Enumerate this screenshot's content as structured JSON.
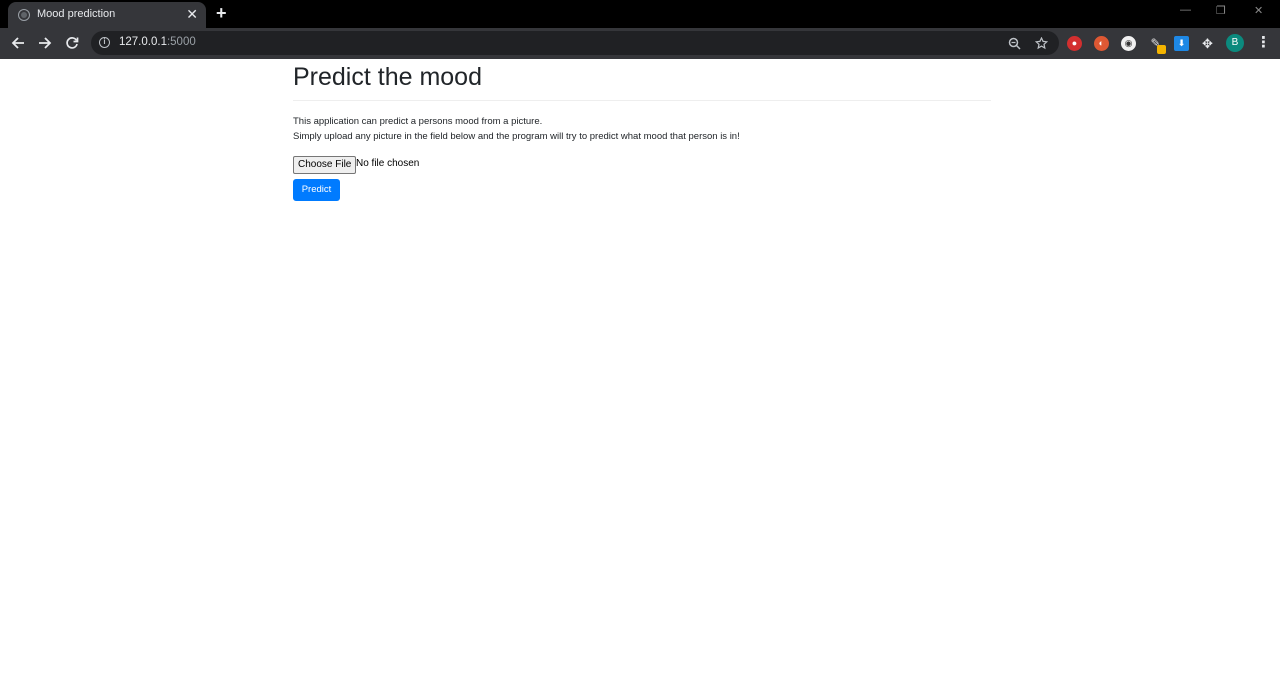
{
  "browser": {
    "tab_title": "Mood prediction",
    "tab_close": "✕",
    "new_tab": "+",
    "url_host": "127.0.0.1",
    "url_port": ":5000",
    "profile_initial": "B",
    "window_controls": {
      "minimize": "—",
      "maximize": "❐",
      "close": "✕"
    }
  },
  "page": {
    "title": "Predict the mood",
    "description_line1": "This application can predict a persons mood from a picture.",
    "description_line2": "Simply upload any picture in the field below and the program will try to predict what mood that person is in!",
    "file_input": {
      "button_label": "Choose File",
      "status": "No file chosen"
    },
    "submit_label": "Predict"
  },
  "colors": {
    "primary_button": "#007bff",
    "chrome_dark": "#35363a",
    "titlebar": "#000000"
  },
  "icons": [
    "globe-icon",
    "close-icon",
    "plus-icon",
    "back-arrow-icon",
    "forward-arrow-icon",
    "reload-icon",
    "info-icon",
    "zoom-icon",
    "star-icon",
    "extension-icons",
    "puzzle-icon",
    "menu-dots-icon"
  ]
}
